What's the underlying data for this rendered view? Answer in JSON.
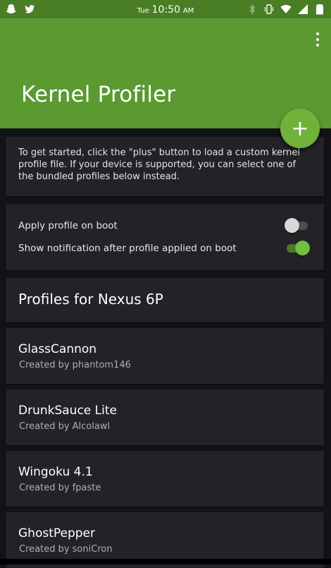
{
  "status_bar": {
    "day": "Tue",
    "time": "10:50",
    "ampm": "AM",
    "left_icons": [
      "snapchat-icon",
      "twitter-icon"
    ],
    "right_icons": [
      "bluetooth-icon",
      "vibrate-icon",
      "wifi-icon",
      "signal-icon",
      "battery-icon"
    ]
  },
  "app_bar": {
    "title": "Kernel Profiler",
    "color": "#5a9a30"
  },
  "fab": {
    "label": "+"
  },
  "intro": {
    "text": "To get started, click the \"plus\" button to load a custom kernel profile file. If your device is supported, you can select one of the bundled profiles below instead."
  },
  "settings": [
    {
      "label": "Apply profile on boot",
      "enabled": false
    },
    {
      "label": "Show notification after profile applied on boot",
      "enabled": true
    }
  ],
  "profiles_header": "Profiles for Nexus 6P",
  "profiles": [
    {
      "name": "GlassCannon",
      "author": "Created by phantom146"
    },
    {
      "name": "DrunkSauce Lite",
      "author": "Created by Alcolawl"
    },
    {
      "name": "Wingoku 4.1",
      "author": "Created by fpaste"
    },
    {
      "name": "GhostPepper",
      "author": "Created by soniCron"
    }
  ],
  "accent": "#6fb23a"
}
